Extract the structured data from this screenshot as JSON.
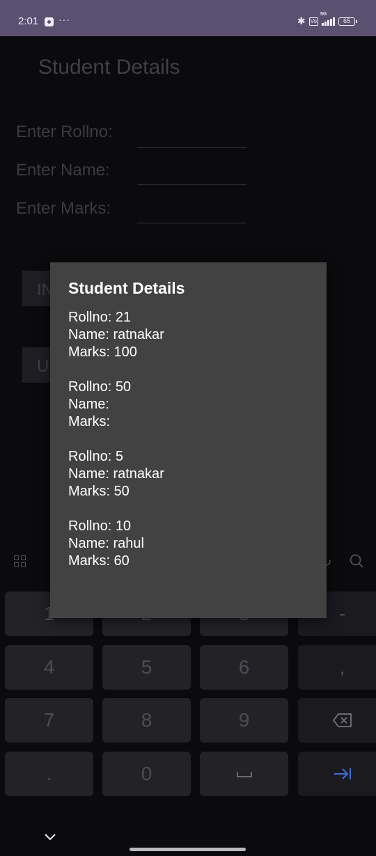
{
  "status_bar": {
    "time": "2:01",
    "more": "···",
    "network": "5G",
    "volte": "Vo",
    "battery": "65"
  },
  "app": {
    "title": "Student Details",
    "fields": [
      {
        "label": "Enter Rollno:",
        "value": ""
      },
      {
        "label": "Enter Name:",
        "value": ""
      },
      {
        "label": "Enter Marks:",
        "value": ""
      }
    ],
    "buttons": [
      "IN",
      "U"
    ]
  },
  "dialog": {
    "title": "Student Details",
    "records": [
      {
        "rollno": "Rollno: 21",
        "name": "Name: ratnakar",
        "marks": "Marks: 100"
      },
      {
        "rollno": "Rollno: 50",
        "name": "Name:",
        "marks": "Marks:"
      },
      {
        "rollno": "Rollno: 5",
        "name": "Name: ratnakar",
        "marks": "Marks: 50"
      },
      {
        "rollno": "Rollno: 10",
        "name": "Name: rahul",
        "marks": "Marks: 60"
      }
    ]
  },
  "keyboard": {
    "rows": [
      [
        "1",
        "2",
        "3",
        "-"
      ],
      [
        "4",
        "5",
        "6",
        ","
      ],
      [
        "7",
        "8",
        "9",
        ""
      ],
      [
        ".",
        "0",
        "",
        ""
      ]
    ],
    "icons": {
      "toolbar_left": "grid-icon",
      "toolbar_mic": "mic-icon",
      "toolbar_search": "search-icon",
      "backspace": "backspace-icon",
      "space": "space-icon",
      "next": "tab-next-icon",
      "hide": "chevron-down-icon"
    },
    "accent_color": "#3d6fd6"
  },
  "colors": {
    "status_bar": "#5a5170",
    "background": "#0b0a0d",
    "dialog": "#424242"
  }
}
